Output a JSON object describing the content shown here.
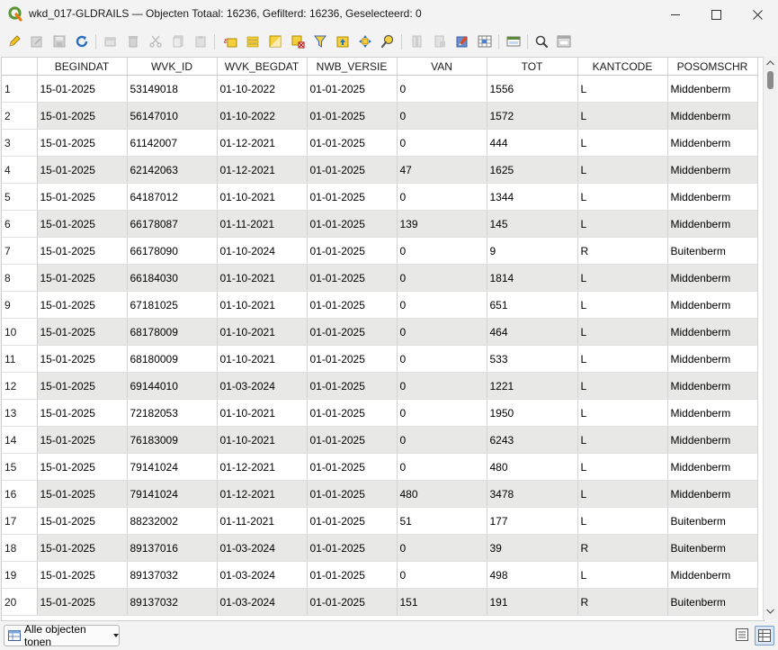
{
  "window": {
    "title": "wkd_017-GLDRAILS — Objecten Totaal: 16236, Gefilterd: 16236, Geselecteerd: 0"
  },
  "toolbar": {
    "icons": [
      "edit-pencil-icon",
      "multi-edit-icon",
      "save-icon",
      "reload-icon",
      "add-feature-icon",
      "delete-icon",
      "cut-icon",
      "copy-icon",
      "paste-icon",
      "select-expression-icon",
      "select-all-icon",
      "invert-selection-icon",
      "deselect-icon",
      "filter-icon",
      "move-to-top-icon",
      "pan-to-selected-icon",
      "zoom-to-selected-icon",
      "new-field-icon",
      "delete-field-icon",
      "field-calculator-icon",
      "conditional-format-icon",
      "dock-icon",
      "actions-icon",
      "organize-columns-icon"
    ]
  },
  "table": {
    "columns": [
      "BEGINDAT",
      "WVK_ID",
      "WVK_BEGDAT",
      "NWB_VERSIE",
      "VAN",
      "TOT",
      "KANTCODE",
      "POSOMSCHR"
    ],
    "rows": [
      [
        "1",
        "15-01-2025",
        "53149018",
        "01-10-2022",
        "01-01-2025",
        "0",
        "1556",
        "L",
        "Middenberm"
      ],
      [
        "2",
        "15-01-2025",
        "56147010",
        "01-10-2022",
        "01-01-2025",
        "0",
        "1572",
        "L",
        "Middenberm"
      ],
      [
        "3",
        "15-01-2025",
        "61142007",
        "01-12-2021",
        "01-01-2025",
        "0",
        "444",
        "L",
        "Middenberm"
      ],
      [
        "4",
        "15-01-2025",
        "62142063",
        "01-12-2021",
        "01-01-2025",
        "47",
        "1625",
        "L",
        "Middenberm"
      ],
      [
        "5",
        "15-01-2025",
        "64187012",
        "01-10-2021",
        "01-01-2025",
        "0",
        "1344",
        "L",
        "Middenberm"
      ],
      [
        "6",
        "15-01-2025",
        "66178087",
        "01-11-2021",
        "01-01-2025",
        "139",
        "145",
        "L",
        "Middenberm"
      ],
      [
        "7",
        "15-01-2025",
        "66178090",
        "01-10-2024",
        "01-01-2025",
        "0",
        "9",
        "R",
        "Buitenberm"
      ],
      [
        "8",
        "15-01-2025",
        "66184030",
        "01-10-2021",
        "01-01-2025",
        "0",
        "1814",
        "L",
        "Middenberm"
      ],
      [
        "9",
        "15-01-2025",
        "67181025",
        "01-10-2021",
        "01-01-2025",
        "0",
        "651",
        "L",
        "Middenberm"
      ],
      [
        "10",
        "15-01-2025",
        "68178009",
        "01-10-2021",
        "01-01-2025",
        "0",
        "464",
        "L",
        "Middenberm"
      ],
      [
        "11",
        "15-01-2025",
        "68180009",
        "01-10-2021",
        "01-01-2025",
        "0",
        "533",
        "L",
        "Middenberm"
      ],
      [
        "12",
        "15-01-2025",
        "69144010",
        "01-03-2024",
        "01-01-2025",
        "0",
        "1221",
        "L",
        "Middenberm"
      ],
      [
        "13",
        "15-01-2025",
        "72182053",
        "01-10-2021",
        "01-01-2025",
        "0",
        "1950",
        "L",
        "Middenberm"
      ],
      [
        "14",
        "15-01-2025",
        "76183009",
        "01-10-2021",
        "01-01-2025",
        "0",
        "6243",
        "L",
        "Middenberm"
      ],
      [
        "15",
        "15-01-2025",
        "79141024",
        "01-12-2021",
        "01-01-2025",
        "0",
        "480",
        "L",
        "Middenberm"
      ],
      [
        "16",
        "15-01-2025",
        "79141024",
        "01-12-2021",
        "01-01-2025",
        "480",
        "3478",
        "L",
        "Middenberm"
      ],
      [
        "17",
        "15-01-2025",
        "88232002",
        "01-11-2021",
        "01-01-2025",
        "51",
        "177",
        "L",
        "Buitenberm"
      ],
      [
        "18",
        "15-01-2025",
        "89137016",
        "01-03-2024",
        "01-01-2025",
        "0",
        "39",
        "R",
        "Buitenberm"
      ],
      [
        "19",
        "15-01-2025",
        "89137032",
        "01-03-2024",
        "01-01-2025",
        "0",
        "498",
        "L",
        "Middenberm"
      ],
      [
        "20",
        "15-01-2025",
        "89137032",
        "01-03-2024",
        "01-01-2025",
        "151",
        "191",
        "R",
        "Buitenberm"
      ]
    ]
  },
  "bottom": {
    "filter_label": "Alle objecten tonen",
    "view_icons": [
      "form-view-icon",
      "table-view-icon"
    ]
  }
}
